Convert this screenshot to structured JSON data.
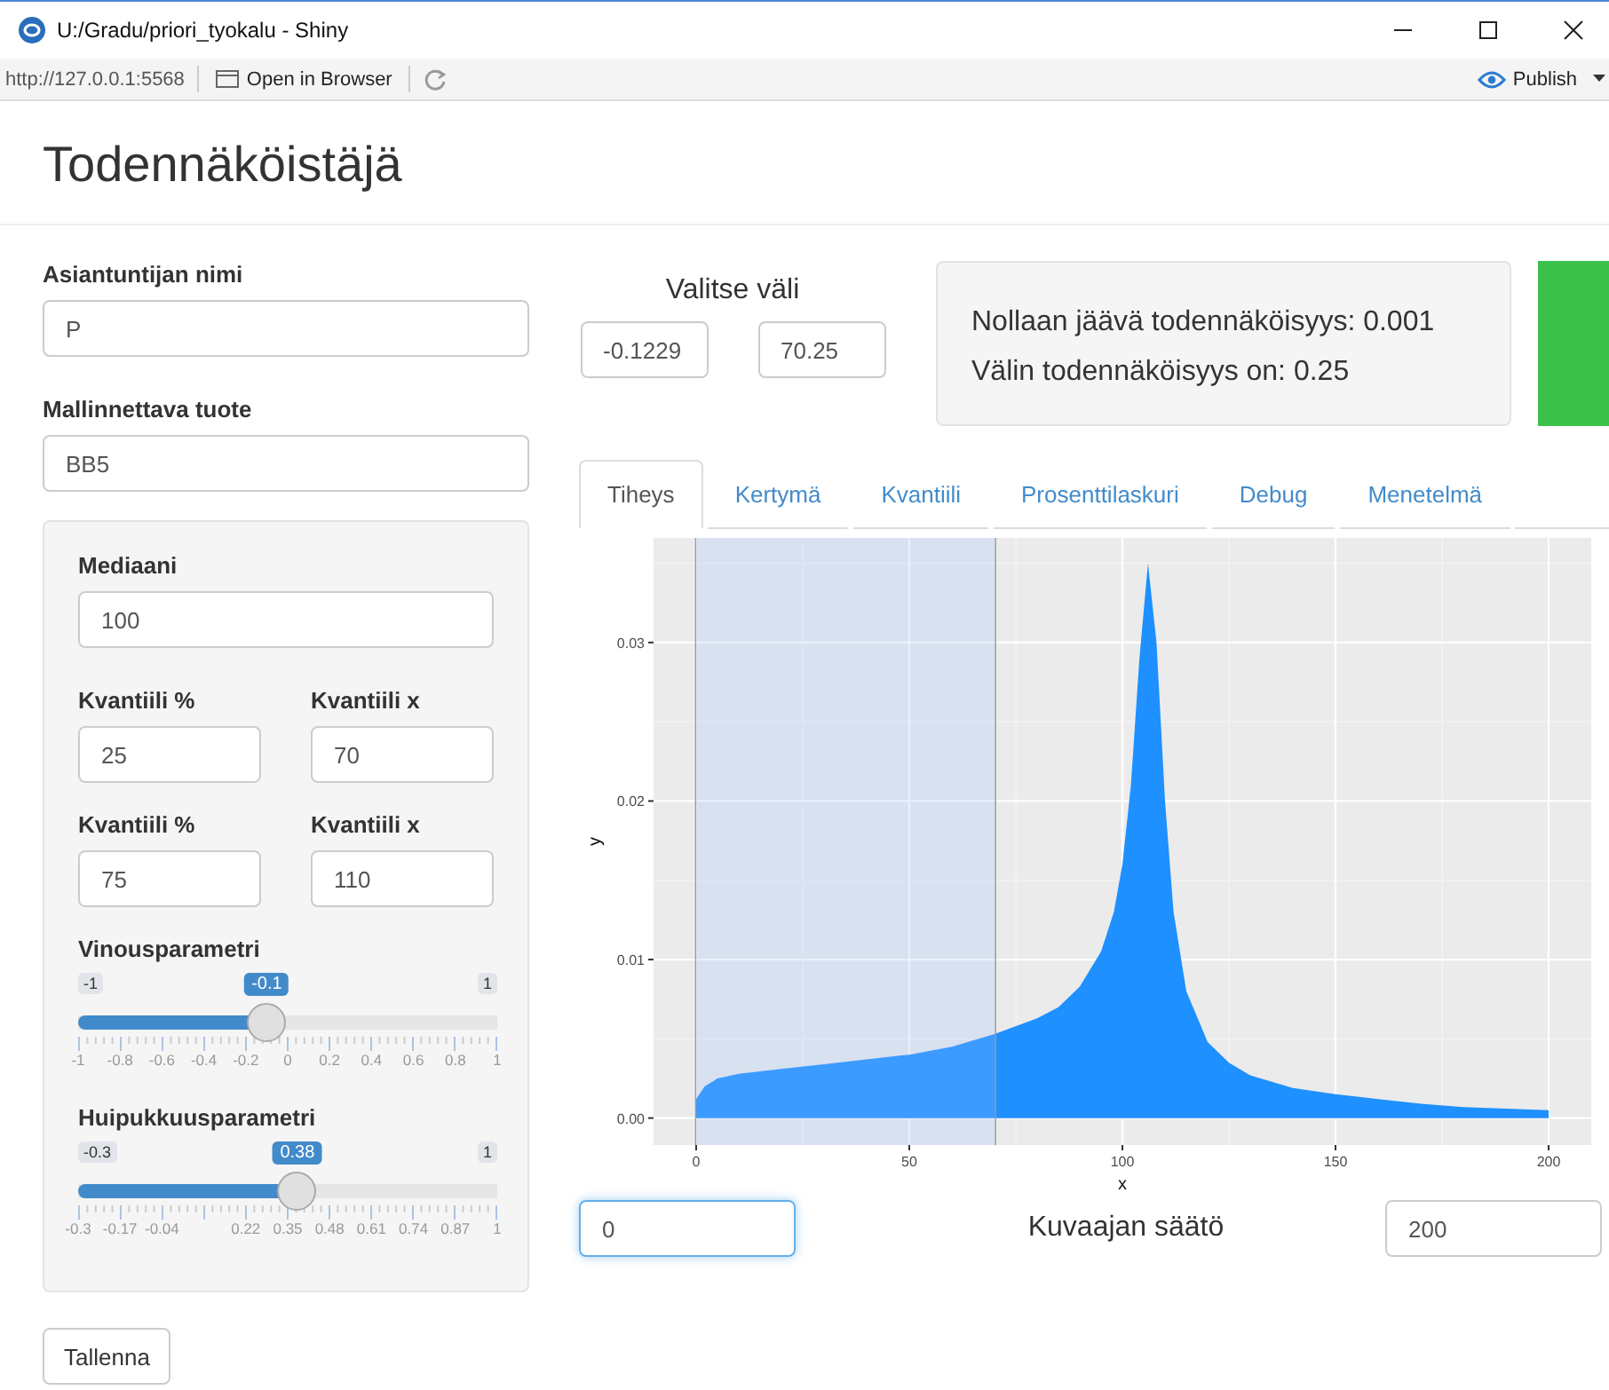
{
  "window": {
    "title": "U:/Gradu/priori_tyokalu - Shiny"
  },
  "toolbar": {
    "url": "http://127.0.0.1:5568",
    "open_button": "Open in Browser",
    "publish_button": "Publish"
  },
  "page_title": "Todennäköistäjä",
  "expert_field": {
    "label": "Asiantuntijan nimi",
    "value": "P"
  },
  "product_field": {
    "label": "Mallinnettava tuote",
    "value": "BB5"
  },
  "panel": {
    "median": {
      "label": "Mediaani",
      "value": "100"
    },
    "quantile_rows": [
      {
        "percent_label": "Kvantiili %",
        "percent_value": "25",
        "x_label": "Kvantiili x",
        "x_value": "70"
      },
      {
        "percent_label": "Kvantiili %",
        "percent_value": "75",
        "x_label": "Kvantiili x",
        "x_value": "110"
      }
    ],
    "sliders": [
      {
        "label": "Vinousparametri",
        "min": "-1",
        "max": "1",
        "value": "-0.1",
        "level": 0.45,
        "ticks": [
          "-1",
          "-0.8",
          "-0.6",
          "-0.4",
          "-0.2",
          "0",
          "0.2",
          "0.4",
          "0.6",
          "0.8",
          "1"
        ]
      },
      {
        "label": "Huipukkuusparametri",
        "min": "-0.3",
        "max": "1",
        "value": "0.38",
        "level": 0.523,
        "ticks": [
          "-0.3",
          "-0.17",
          "-0.04",
          "0.22",
          "0.35",
          "0.48",
          "0.61",
          "0.74",
          "0.87",
          "1"
        ]
      }
    ]
  },
  "save_button": "Tallenna",
  "interval": {
    "title": "Valitse väli",
    "from": "-0.1229",
    "to": "70.25"
  },
  "info_box": {
    "lines": [
      "Nollaan jäävä todennäköisyys: 0.001",
      "Välin todennäköisyys on: 0.25"
    ]
  },
  "tabs": [
    {
      "label": "Tiheys",
      "selected": true
    },
    {
      "label": "Kertymä",
      "selected": false
    },
    {
      "label": "Kvantiili",
      "selected": false
    },
    {
      "label": "Prosenttilaskuri",
      "selected": false
    },
    {
      "label": "Debug",
      "selected": false
    },
    {
      "label": "Menetelmä",
      "selected": false
    }
  ],
  "plot": {
    "chart_data": {
      "type": "area",
      "xlabel": "x",
      "ylabel": "y",
      "x": [
        0,
        2,
        5,
        10,
        20,
        30,
        40,
        50,
        60,
        70,
        80,
        85,
        90,
        95,
        98,
        100,
        102,
        104,
        106,
        108,
        110,
        112,
        115,
        120,
        125,
        130,
        140,
        150,
        160,
        170,
        180,
        190,
        200
      ],
      "series": [
        {
          "color": "#1e90ff",
          "values": [
            0.0012,
            0.002,
            0.0025,
            0.0028,
            0.0031,
            0.0034,
            0.0037,
            0.004,
            0.0045,
            0.0053,
            0.0063,
            0.007,
            0.0083,
            0.0105,
            0.013,
            0.016,
            0.021,
            0.029,
            0.035,
            0.03,
            0.02,
            0.013,
            0.008,
            0.0048,
            0.0035,
            0.0027,
            0.0019,
            0.0015,
            0.0012,
            0.0009,
            0.0007,
            0.0006,
            0.0005
          ]
        }
      ],
      "xlim": [
        -10,
        210
      ],
      "ylim": [
        -0.0017,
        0.0366
      ],
      "xticks": [
        0,
        50,
        100,
        150,
        200
      ],
      "yticks": [
        {
          "value": 0,
          "label": "0.00"
        },
        {
          "value": 0.01,
          "label": "0.01"
        },
        {
          "value": 0.02,
          "label": "0.02"
        },
        {
          "value": 0.03,
          "label": "0.03"
        }
      ],
      "grid": true,
      "bands": [
        {
          "axis": "x",
          "from": -0.1229,
          "to": 70.25
        }
      ],
      "ref_lines": [
        {
          "axis": "x",
          "value": -0.1229
        },
        {
          "axis": "x",
          "value": 70.25
        }
      ]
    }
  },
  "plot_controls": {
    "min": "0",
    "title": "Kuvaajan säätö",
    "max": "200"
  }
}
